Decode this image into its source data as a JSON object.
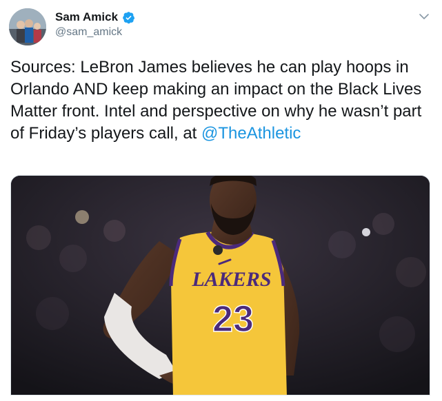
{
  "author": {
    "display_name": "Sam Amick",
    "handle": "@sam_amick",
    "verified": true
  },
  "tweet": {
    "text": "Sources: LeBron James believes he can play hoops in Orlando AND keep making an impact on the Black Lives Matter front. Intel and perspective on why he wasn’t part of Friday’s players call, at ",
    "mention": "@TheAthletic"
  },
  "media": {
    "jersey_team": "LAKERS",
    "jersey_number": "23",
    "jersey_color": "#f5c63a",
    "trim_color": "#4b2a7b"
  },
  "colors": {
    "accent": "#1b95e0",
    "verified": "#1da1f2",
    "text": "#14171a",
    "secondary": "#657786"
  },
  "icons": [
    "verified-badge-icon",
    "chevron-down-icon"
  ]
}
